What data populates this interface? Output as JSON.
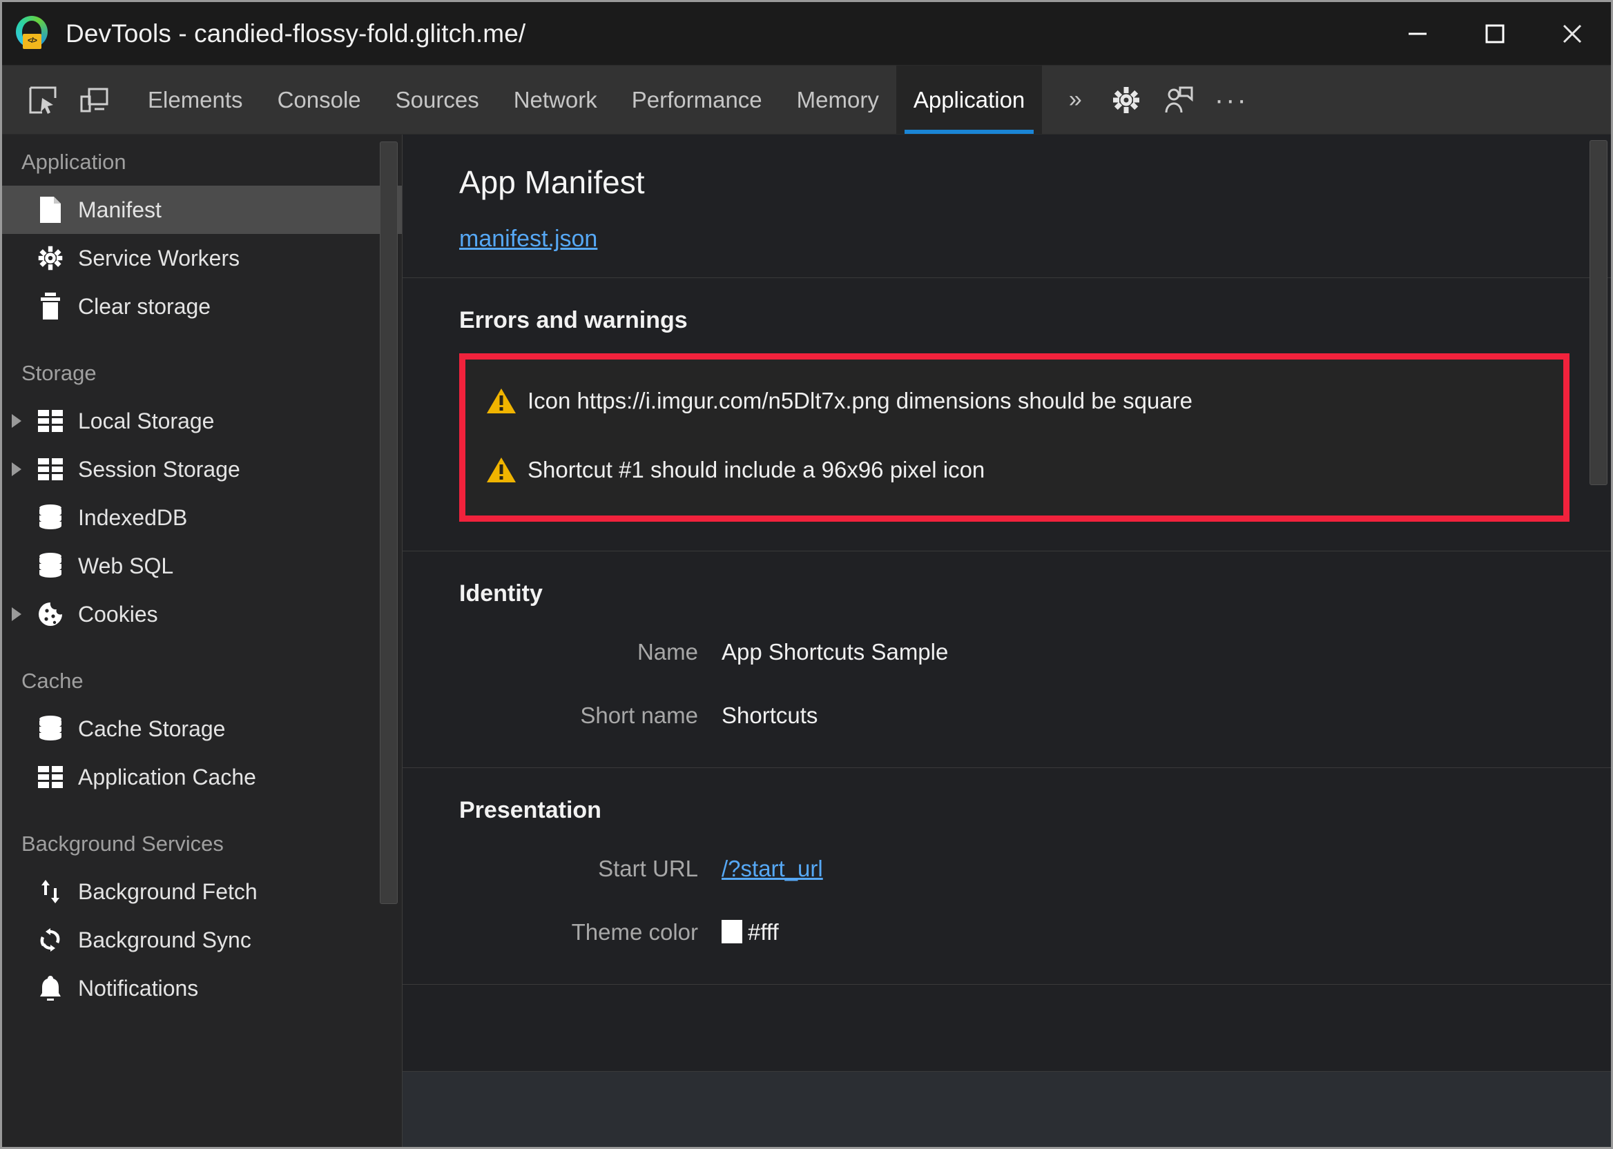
{
  "window": {
    "title": "DevTools - candied-flossy-fold.glitch.me/",
    "app_icon": "edge-devtools-icon",
    "badge_text": "</>",
    "controls": {
      "minimize": "minimize-button",
      "maximize": "maximize-button",
      "close": "close-button"
    }
  },
  "toolbar": {
    "inspect_icon": "inspect-element-icon",
    "device_icon": "device-toolbar-icon",
    "tabs": [
      {
        "label": "Elements",
        "active": false
      },
      {
        "label": "Console",
        "active": false
      },
      {
        "label": "Sources",
        "active": false
      },
      {
        "label": "Network",
        "active": false
      },
      {
        "label": "Performance",
        "active": false
      },
      {
        "label": "Memory",
        "active": false
      },
      {
        "label": "Application",
        "active": true
      }
    ],
    "more_tabs": "»",
    "settings_icon": "gear-icon",
    "feedback_icon": "feedback-icon",
    "overflow": "···"
  },
  "sidebar": {
    "sections": [
      {
        "title": "Application",
        "items": [
          {
            "label": "Manifest",
            "icon": "document-icon",
            "selected": true,
            "twisty": false
          },
          {
            "label": "Service Workers",
            "icon": "gear-icon",
            "selected": false,
            "twisty": false
          },
          {
            "label": "Clear storage",
            "icon": "trash-icon",
            "selected": false,
            "twisty": false
          }
        ]
      },
      {
        "title": "Storage",
        "items": [
          {
            "label": "Local Storage",
            "icon": "table-icon",
            "selected": false,
            "twisty": true
          },
          {
            "label": "Session Storage",
            "icon": "table-icon",
            "selected": false,
            "twisty": true
          },
          {
            "label": "IndexedDB",
            "icon": "database-icon",
            "selected": false,
            "twisty": false
          },
          {
            "label": "Web SQL",
            "icon": "database-icon",
            "selected": false,
            "twisty": false
          },
          {
            "label": "Cookies",
            "icon": "cookie-icon",
            "selected": false,
            "twisty": true
          }
        ]
      },
      {
        "title": "Cache",
        "items": [
          {
            "label": "Cache Storage",
            "icon": "database-icon",
            "selected": false,
            "twisty": false
          },
          {
            "label": "Application Cache",
            "icon": "table-icon",
            "selected": false,
            "twisty": false
          }
        ]
      },
      {
        "title": "Background Services",
        "items": [
          {
            "label": "Background Fetch",
            "icon": "updown-arrows-icon",
            "selected": false,
            "twisty": false
          },
          {
            "label": "Background Sync",
            "icon": "sync-icon",
            "selected": false,
            "twisty": false
          },
          {
            "label": "Notifications",
            "icon": "bell-icon",
            "selected": false,
            "twisty": false
          }
        ]
      }
    ]
  },
  "main": {
    "title": "App Manifest",
    "manifest_link": "manifest.json",
    "errors_section": {
      "heading": "Errors and warnings",
      "highlight_color": "#f1223c",
      "items": [
        {
          "icon": "warning-icon",
          "text": "Icon https://i.imgur.com/n5Dlt7x.png dimensions should be square"
        },
        {
          "icon": "warning-icon",
          "text": "Shortcut #1 should include a 96x96 pixel icon"
        }
      ]
    },
    "identity_section": {
      "heading": "Identity",
      "fields": [
        {
          "label": "Name",
          "value": "App Shortcuts Sample",
          "is_link": false
        },
        {
          "label": "Short name",
          "value": "Shortcuts",
          "is_link": false
        }
      ]
    },
    "presentation_section": {
      "heading": "Presentation",
      "fields": [
        {
          "label": "Start URL",
          "value": "/?start_url",
          "is_link": true
        },
        {
          "label": "Theme color",
          "value": "#fff",
          "is_link": false,
          "swatch": "#ffffff"
        }
      ]
    }
  }
}
